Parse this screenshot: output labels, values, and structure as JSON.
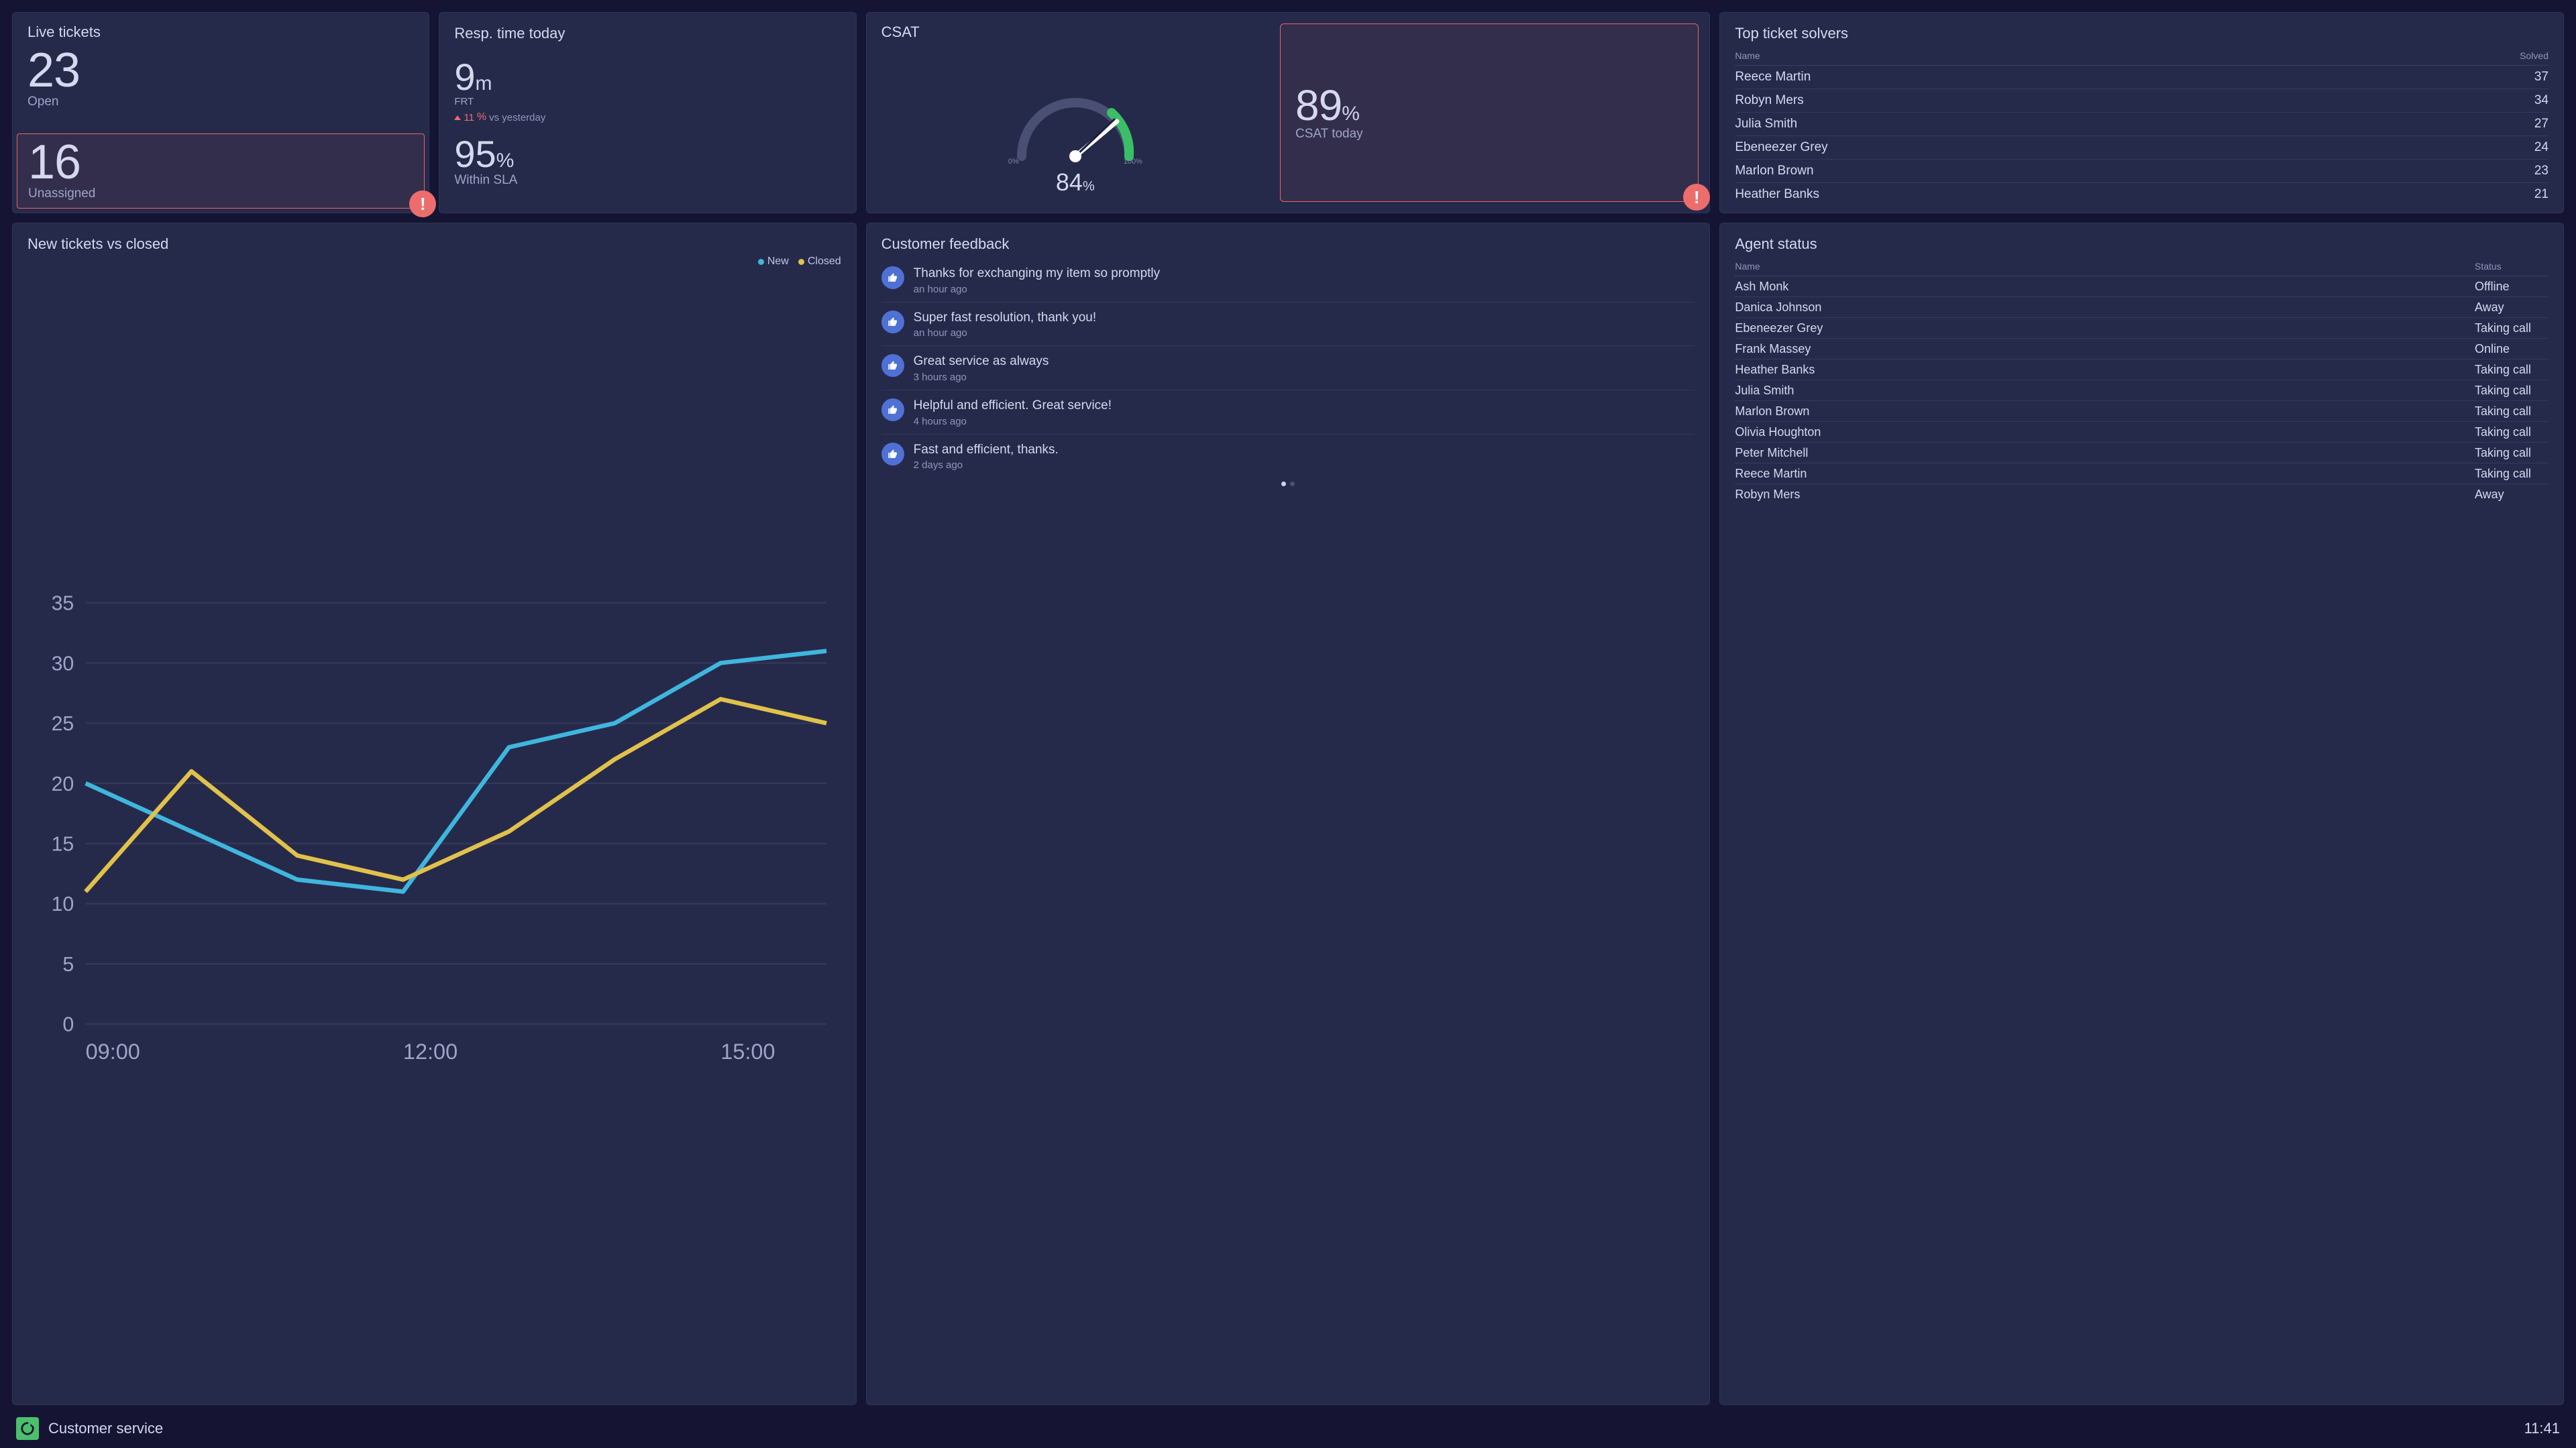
{
  "live_tickets": {
    "title": "Live tickets",
    "open_value": "23",
    "open_label": "Open",
    "unassigned_value": "16",
    "unassigned_label": "Unassigned"
  },
  "resp_time": {
    "title": "Resp. time today",
    "frt_value": "9",
    "frt_unit": "m",
    "frt_label": "FRT",
    "delta_value": "11",
    "delta_unit": "%",
    "delta_suffix": "vs yesterday",
    "sla_value": "95",
    "sla_unit": "%",
    "sla_label": "Within SLA"
  },
  "csat": {
    "title": "CSAT",
    "gauge_min": "0",
    "gauge_max": "100",
    "gauge_unit": "%",
    "overall_value": "84",
    "overall_unit": "%",
    "today_value": "89",
    "today_unit": "%",
    "today_label": "CSAT today"
  },
  "solvers": {
    "title": "Top ticket solvers",
    "col_name": "Name",
    "col_solved": "Solved",
    "rows": [
      {
        "name": "Reece Martin",
        "solved": "37"
      },
      {
        "name": "Robyn Mers",
        "solved": "34"
      },
      {
        "name": "Julia Smith",
        "solved": "27"
      },
      {
        "name": "Ebeneezer Grey",
        "solved": "24"
      },
      {
        "name": "Marlon Brown",
        "solved": "23"
      },
      {
        "name": "Heather Banks",
        "solved": "21"
      }
    ]
  },
  "tickets_chart": {
    "title": "New tickets vs closed",
    "legend_new": "New",
    "legend_closed": "Closed"
  },
  "feedback": {
    "title": "Customer feedback",
    "items": [
      {
        "text": "Thanks for exchanging my item so promptly",
        "time": "an hour ago"
      },
      {
        "text": "Super fast resolution, thank you!",
        "time": "an hour ago"
      },
      {
        "text": "Great service as always",
        "time": "3 hours ago"
      },
      {
        "text": "Helpful and efficient. Great service!",
        "time": "4 hours ago"
      },
      {
        "text": "Fast and efficient, thanks.",
        "time": "2 days ago"
      }
    ]
  },
  "agents": {
    "title": "Agent status",
    "col_name": "Name",
    "col_status": "Status",
    "rows": [
      {
        "name": "Ash Monk",
        "status": "Offline"
      },
      {
        "name": "Danica Johnson",
        "status": "Away"
      },
      {
        "name": "Ebeneezer Grey",
        "status": "Taking call"
      },
      {
        "name": "Frank Massey",
        "status": "Online"
      },
      {
        "name": "Heather Banks",
        "status": "Taking call"
      },
      {
        "name": "Julia Smith",
        "status": "Taking call"
      },
      {
        "name": "Marlon Brown",
        "status": "Taking call"
      },
      {
        "name": "Olivia Houghton",
        "status": "Taking call"
      },
      {
        "name": "Peter Mitchell",
        "status": "Taking call"
      },
      {
        "name": "Reece Martin",
        "status": "Taking call"
      },
      {
        "name": "Robyn Mers",
        "status": "Away"
      }
    ]
  },
  "footer": {
    "title": "Customer service",
    "time": "11:41"
  },
  "chart_data": {
    "type": "line",
    "x_labels": [
      "09:00",
      "12:00",
      "15:00"
    ],
    "y_ticks": [
      0,
      5,
      10,
      15,
      20,
      25,
      30,
      35
    ],
    "ylim": [
      0,
      35
    ],
    "series": [
      {
        "name": "New",
        "color": "#3fb6de",
        "values": [
          20,
          16,
          12,
          11,
          23,
          25,
          30,
          31
        ]
      },
      {
        "name": "Closed",
        "color": "#e0c24b",
        "values": [
          11,
          21,
          14,
          12,
          16,
          22,
          27,
          25
        ]
      }
    ]
  },
  "colors": {
    "alert": "#ed6d6d",
    "accent_blue": "#3fb6de",
    "accent_yellow": "#e0c24b",
    "accent_green": "#4bbf6b"
  }
}
